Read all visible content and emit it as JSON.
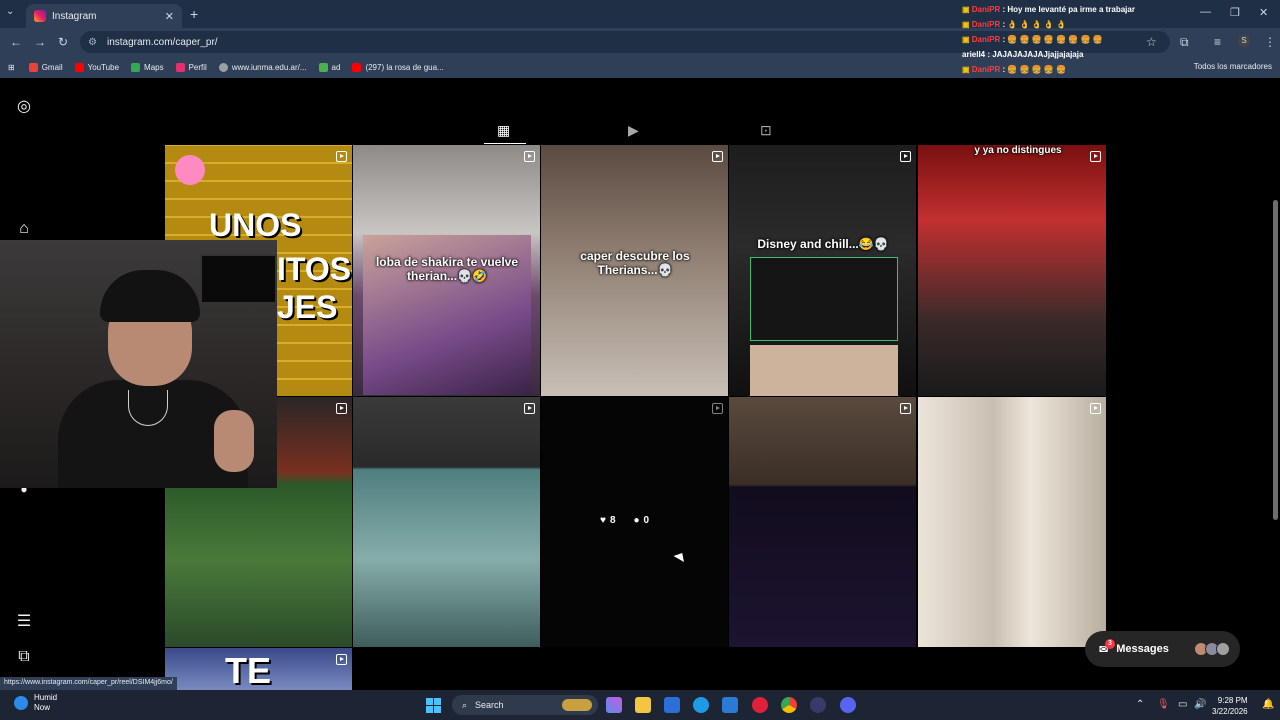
{
  "browser": {
    "tab_title": "Instagram",
    "new_tab": "+",
    "url": "instagram.com/caper_pr/",
    "bookmarks": [
      {
        "label": "Gmail",
        "color": "#ea4335"
      },
      {
        "label": "YouTube",
        "color": "#ff0000"
      },
      {
        "label": "Maps",
        "color": "#34a853"
      },
      {
        "label": "Perfil",
        "color": "#e1306c"
      },
      {
        "label": "www.iunma.edu.ar/...",
        "color": "#9aa0a6"
      },
      {
        "label": "ad",
        "color": "#4caf50"
      },
      {
        "label": "(297) la rosa de gua...",
        "color": "#ff0000"
      }
    ],
    "all_bookmarks": "Todos los marcadores",
    "status_url": "https://www.instagram.com/caper_pr/reel/DSIM4jj6mo/"
  },
  "chat": [
    {
      "user": "DaniPR",
      "message": "Hoy me levanté pa irme a trabajar"
    },
    {
      "user": "DaniPR",
      "message": "👌 👌 👌 👌 👌"
    },
    {
      "user": "DaniPR",
      "message": "🍔 🍔 🍔 🍔 🍔 🍔 🍔 🍔"
    },
    {
      "user": "ariell4",
      "message": "JAJAJAJAJAJjajjajajaja"
    },
    {
      "user": "DaniPR",
      "message": "🍔 🍔 🍔 🍔 🍔"
    }
  ],
  "grid": {
    "captions": {
      "t1": "UNOS",
      "t1b": "ITOS",
      "t1c": "JES",
      "t2": "loba de shakira te vuelve therian...💀🤣",
      "t3": "caper descubre los Therians...💀",
      "t4": "Disney and chill...😂💀",
      "t5": "y ya no distingues",
      "t16": "TE"
    },
    "hover_likes": "8",
    "hover_comments": "0"
  },
  "messages": {
    "label": "Messages",
    "badge": "3"
  },
  "taskbar": {
    "weather_title": "Humid",
    "weather_sub": "Now",
    "search": "Search",
    "time": "9:28 PM",
    "date": "3/22/2026"
  }
}
